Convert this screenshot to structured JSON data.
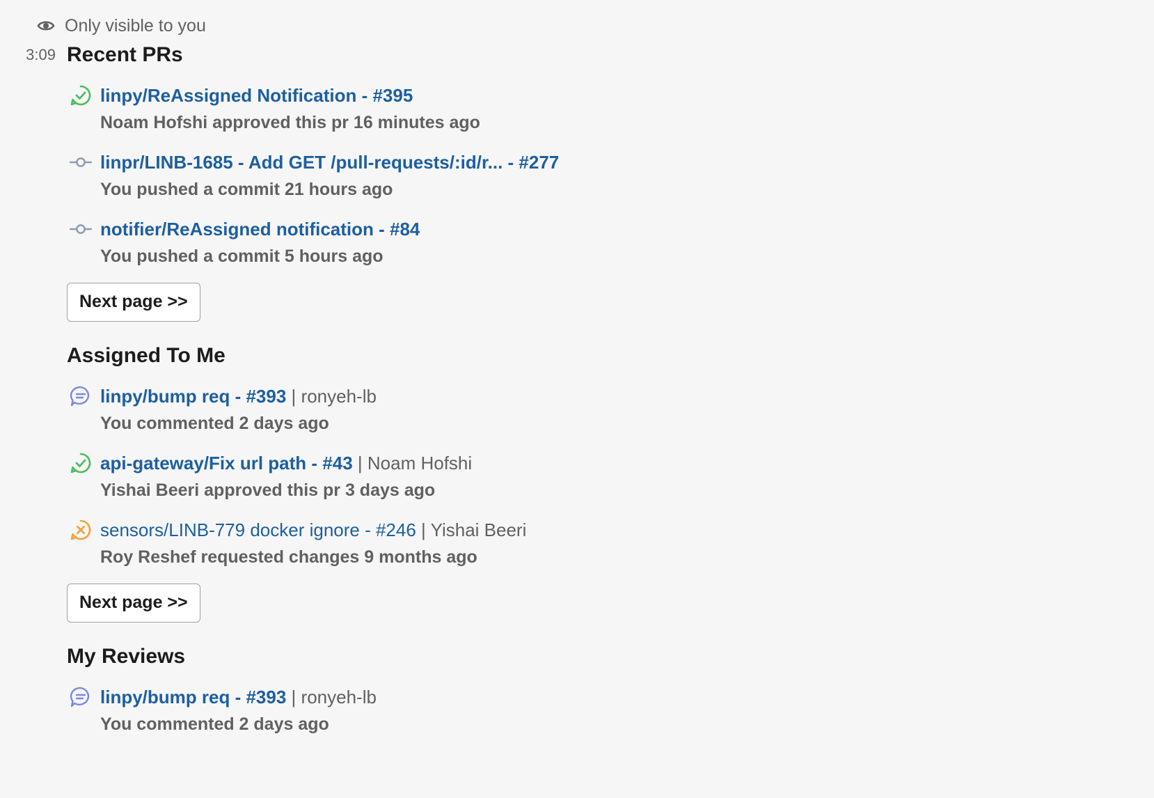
{
  "message": {
    "visibility_text": "Only visible to you",
    "timestamp": "3:09"
  },
  "colors": {
    "link": "#1d5fa0",
    "approved": "#4cbd5c",
    "commit": "#8e9bb0",
    "commented": "#7b85e8",
    "changes_requested": "#f3a33b",
    "muted_text": "#616061",
    "background": "#f6f6f6"
  },
  "sections": {
    "recent": {
      "title": "Recent PRs",
      "items": [
        {
          "icon": "approved-check-icon",
          "title": "linpy/ReAssigned Notification - #395",
          "subtitle": "Noam Hofshi approved this pr 16 minutes ago"
        },
        {
          "icon": "commit-icon",
          "title": "linpr/LINB-1685 - Add GET /pull-requests/:id/r... - #277",
          "subtitle": "You pushed a commit 21 hours ago"
        },
        {
          "icon": "commit-icon",
          "title": "notifier/ReAssigned notification - #84",
          "subtitle": "You pushed a commit 5 hours ago"
        }
      ],
      "next_label": "Next page >>"
    },
    "assigned": {
      "title": "Assigned To Me",
      "items": [
        {
          "icon": "comment-bubble-icon",
          "title": "linpy/bump req - #393",
          "separator": "|",
          "author": "ronyeh-lb",
          "subtitle": "You commented 2 days ago"
        },
        {
          "icon": "approved-check-icon",
          "title": "api-gateway/Fix url path - #43",
          "separator": "|",
          "author": "Noam Hofshi",
          "subtitle": "Yishai Beeri approved this pr 3 days ago"
        },
        {
          "icon": "changes-requested-icon",
          "title": "sensors/LINB-779 docker ignore - #246",
          "separator": "|",
          "author": "Yishai Beeri",
          "subtitle": "Roy Reshef requested changes 9 months ago"
        }
      ],
      "next_label": "Next page >>"
    },
    "reviews": {
      "title": "My Reviews",
      "items": [
        {
          "icon": "comment-bubble-icon",
          "title": "linpy/bump req - #393",
          "separator": "|",
          "author": "ronyeh-lb",
          "subtitle": "You commented 2 days ago"
        }
      ]
    }
  }
}
